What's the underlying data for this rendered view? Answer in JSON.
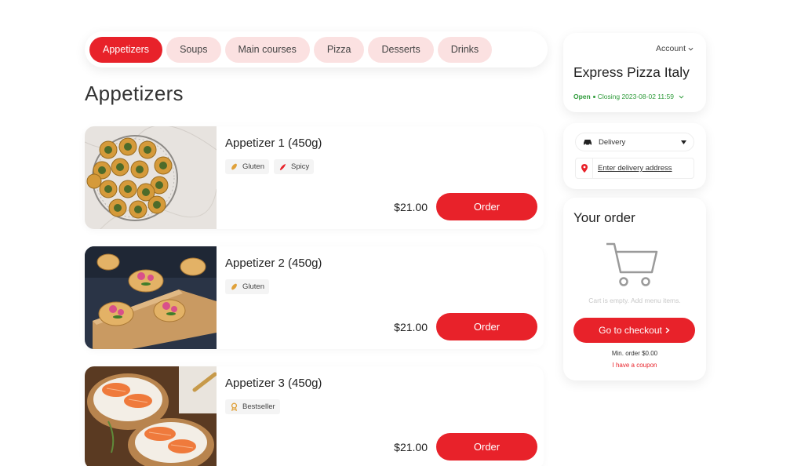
{
  "categories": [
    "Appetizers",
    "Soups",
    "Main courses",
    "Pizza",
    "Desserts",
    "Drinks"
  ],
  "section_title": "Appetizers",
  "items": [
    {
      "name": "Appetizer 1 (450g)",
      "tags": [
        {
          "icon": "wheat-icon",
          "label": "Gluten"
        },
        {
          "icon": "chili-icon",
          "label": "Spicy"
        }
      ],
      "price": "$21.00",
      "order_label": "Order"
    },
    {
      "name": "Appetizer 2 (450g)",
      "tags": [
        {
          "icon": "wheat-icon",
          "label": "Gluten"
        }
      ],
      "price": "$21.00",
      "order_label": "Order"
    },
    {
      "name": "Appetizer 3 (450g)",
      "tags": [
        {
          "icon": "award-icon",
          "label": "Bestseller"
        }
      ],
      "price": "$21.00",
      "order_label": "Order"
    }
  ],
  "store": {
    "account_label": "Account",
    "name": "Express Pizza Italy",
    "status_open": "Open",
    "status_closing": "Closing 2023-08-02 11:59"
  },
  "delivery": {
    "mode": "Delivery",
    "address_placeholder": "Enter delivery address"
  },
  "order": {
    "title": "Your order",
    "empty_text": "Cart is empty. Add menu items.",
    "checkout_label": "Go to checkout",
    "min_order": "Min. order $0.00",
    "coupon_link": "I have a coupon"
  },
  "colors": {
    "accent": "#e8222a",
    "tab_bg": "#fbe1e1",
    "status_green": "#2e9b3a"
  }
}
